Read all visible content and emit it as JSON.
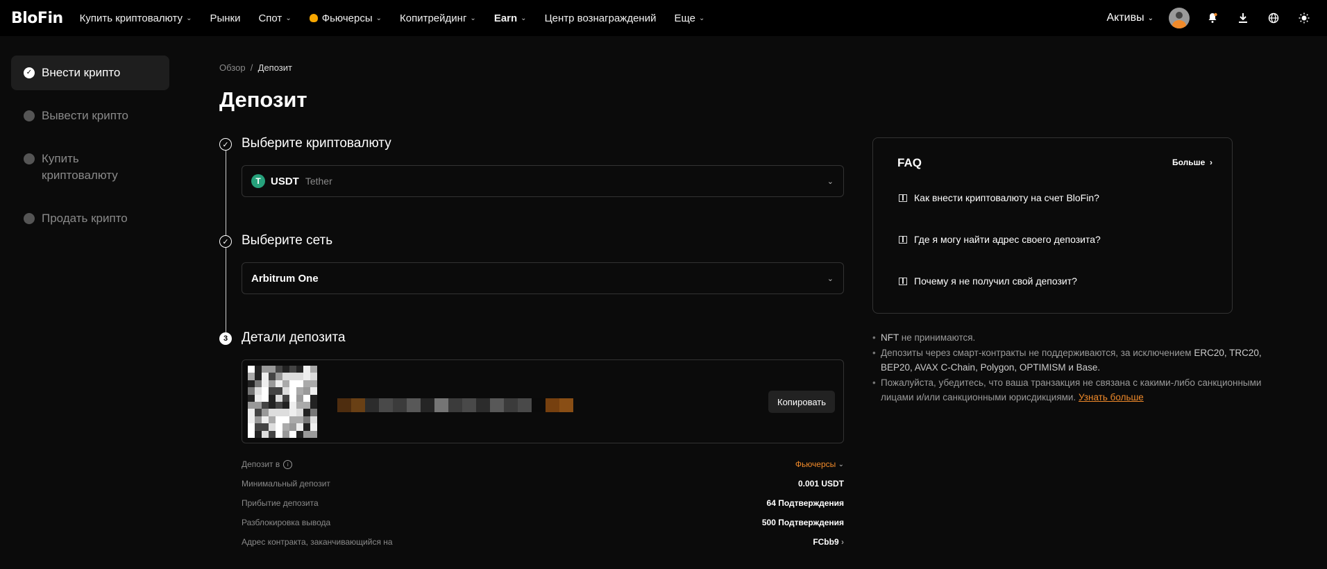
{
  "nav": {
    "logo": "BloFin",
    "items": [
      {
        "label": "Купить криптовалюту",
        "dropdown": true
      },
      {
        "label": "Рынки",
        "dropdown": false
      },
      {
        "label": "Спот",
        "dropdown": true
      },
      {
        "label": "Фьючерсы",
        "dropdown": true
      },
      {
        "label": "Копитрейдинг",
        "dropdown": true
      },
      {
        "label": "Earn",
        "dropdown": true
      },
      {
        "label": "Центр вознаграждений",
        "dropdown": false
      },
      {
        "label": "Еще",
        "dropdown": true
      }
    ],
    "assets_label": "Активы"
  },
  "sidebar": {
    "items": [
      {
        "label": "Внести крипто",
        "active": true
      },
      {
        "label": "Вывести крипто",
        "active": false
      },
      {
        "label": "Купить криптовалюту",
        "active": false
      },
      {
        "label": "Продать крипто",
        "active": false
      }
    ]
  },
  "breadcrumb": {
    "parent": "Обзор",
    "separator": "/",
    "current": "Депозит"
  },
  "page_title": "Депозит",
  "steps": {
    "s1": {
      "title": "Выберите криптовалюту",
      "coin": "USDT",
      "coin_name": "Tether"
    },
    "s2": {
      "title": "Выберите сеть",
      "network": "Arbitrum One"
    },
    "s3": {
      "number": "3",
      "title": "Детали депозита",
      "copy_label": "Копировать"
    }
  },
  "details": {
    "deposit_to_label": "Депозит в",
    "deposit_to_value": "Фьючерсы",
    "min_label": "Минимальный депозит",
    "min_value": "0.001 USDT",
    "arrival_label": "Прибытие депозита",
    "arrival_value": "64 Подтверждения",
    "unlock_label": "Разблокировка вывода",
    "unlock_value": "500 Подтверждения",
    "contract_label": "Адрес контракта, заканчивающийся на",
    "contract_value": "FCbb9"
  },
  "faq": {
    "title": "FAQ",
    "more": "Больше",
    "items": [
      "Как внести криптовалюту на счет BloFin?",
      "Где я могу найти адрес своего депозита?",
      "Почему я не получил свой депозит?"
    ]
  },
  "notes": {
    "n1_em": "NFT",
    "n1": " не принимаются.",
    "n2": "Депозиты через смарт-контракты не поддерживаются, за исключением ",
    "n2_em": "ERC20, TRC20, BEP20, AVAX C-Chain, Polygon, OPTIMISM и Base.",
    "n3": "Пожалуйста, убедитесь, что ваша транзакция не связана с какими-либо санкционными лицами и/или санкционными юрисдикциями. ",
    "n3_link": "Узнать больше"
  },
  "colors": {
    "accent": "#f08a2a",
    "bg": "#0b0b0b",
    "tether": "#26a17b"
  }
}
